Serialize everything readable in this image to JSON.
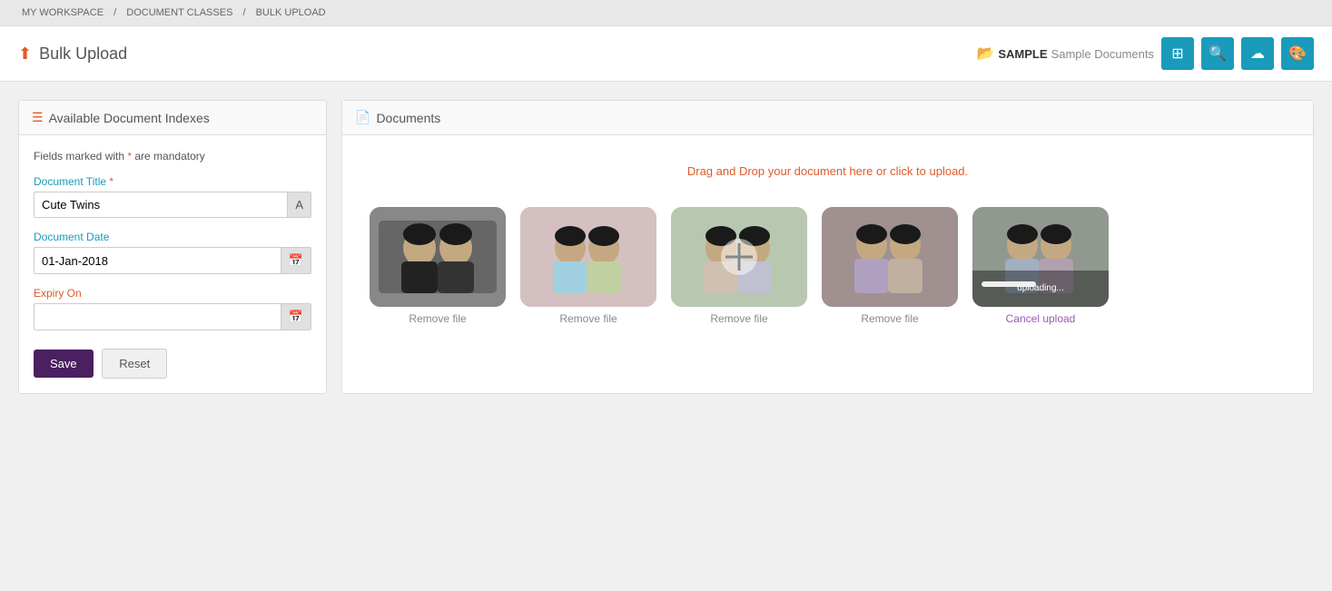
{
  "breadcrumb": {
    "items": [
      "MY WORKSPACE",
      "DOCUMENT CLASSES",
      "BULK UPLOAD"
    ],
    "separator": "/"
  },
  "header": {
    "title": "Bulk Upload",
    "upload_icon": "↑",
    "workspace": {
      "folder_icon": "📁",
      "name": "SAMPLE",
      "sub": "Sample Documents"
    },
    "toolbar_buttons": [
      {
        "name": "grid-view",
        "icon": "⊞"
      },
      {
        "name": "search",
        "icon": "🔍"
      },
      {
        "name": "cloud-upload",
        "icon": "☁"
      },
      {
        "name": "palette",
        "icon": "🎨"
      }
    ]
  },
  "left_panel": {
    "title": "Available Document Indexes",
    "list_icon": "≡",
    "mandatory_note": "Fields marked with * are mandatory",
    "star": "*",
    "fields": [
      {
        "label": "Document Title",
        "required": true,
        "value": "Cute Twins",
        "type": "text",
        "btn_icon": "A"
      },
      {
        "label": "Document Date",
        "required": false,
        "value": "01-Jan-2018",
        "type": "date",
        "btn_icon": "📅"
      },
      {
        "label": "Expiry On",
        "required": false,
        "value": "",
        "type": "date",
        "btn_icon": "📅",
        "label_color": "red"
      }
    ],
    "buttons": {
      "save": "Save",
      "reset": "Reset"
    }
  },
  "right_panel": {
    "title": "Documents",
    "doc_icon": "📄",
    "drop_zone_text": "Drag and Drop your document here or click to upload.",
    "files": [
      {
        "id": 1,
        "action": "Remove file",
        "thumb_class": "thumb-1"
      },
      {
        "id": 2,
        "action": "Remove file",
        "thumb_class": "thumb-2"
      },
      {
        "id": 3,
        "action": "Remove file",
        "thumb_class": "thumb-3"
      },
      {
        "id": 4,
        "action": "Remove file",
        "thumb_class": "thumb-4"
      },
      {
        "id": 5,
        "action": "Cancel upload",
        "thumb_class": "thumb-5",
        "is_cancel": true
      }
    ]
  },
  "colors": {
    "accent": "#e05a2b",
    "teal": "#1a9bbc",
    "purple": "#4a2060",
    "light_purple": "#9b59b6"
  }
}
